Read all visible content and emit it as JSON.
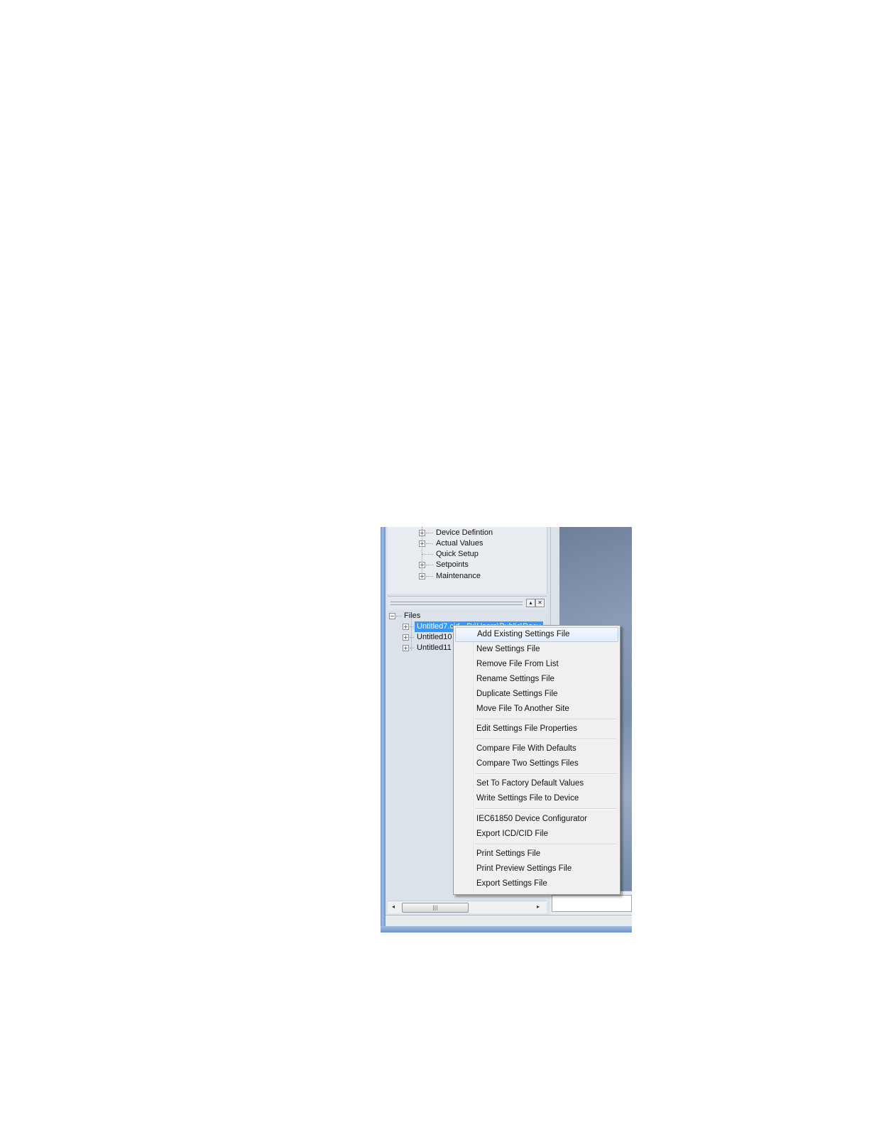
{
  "tree": {
    "top_items": [
      {
        "label": "Device Defintion",
        "expandable": true
      },
      {
        "label": "Actual Values",
        "expandable": true
      },
      {
        "label": "Quick Setup",
        "expandable": false
      },
      {
        "label": "Setpoints",
        "expandable": true
      },
      {
        "label": "Maintenance",
        "expandable": true
      }
    ],
    "files_root": "Files",
    "files": [
      {
        "label": "Untitled7.cid - D:\\Users\\Public\\Docu",
        "selected": true
      },
      {
        "label": "Untitled10",
        "selected": false
      },
      {
        "label": "Untitled11",
        "selected": false
      }
    ]
  },
  "icons": {
    "expand": "+",
    "collapse": "−",
    "pin": "▴",
    "close": "✕",
    "scroll_left": "◂",
    "scroll_right": "▸",
    "grip": "|||"
  },
  "context_menu": {
    "groups": [
      [
        "Add Existing Settings File",
        "New Settings File",
        "Remove File From List",
        "Rename Settings File",
        "Duplicate Settings File",
        "Move File To Another Site"
      ],
      [
        "Edit Settings File Properties"
      ],
      [
        "Compare File With Defaults",
        "Compare Two Settings Files"
      ],
      [
        "Set To Factory Default Values",
        "Write Settings File to Device"
      ],
      [
        "IEC61850 Device Configurator",
        "Export ICD/CID File"
      ],
      [
        "Print Settings File",
        "Print Preview Settings File",
        "Export Settings File"
      ]
    ]
  }
}
